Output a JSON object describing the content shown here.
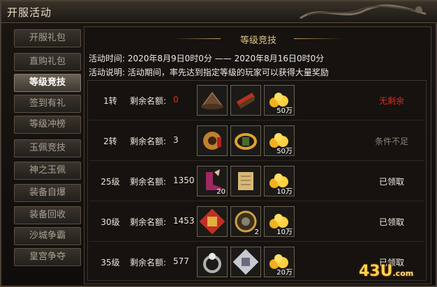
{
  "window": {
    "title": "开服活动"
  },
  "sidebar": {
    "items": [
      {
        "label": "开服礼包"
      },
      {
        "label": "直购礼包"
      },
      {
        "label": "等级竞技"
      },
      {
        "label": "签到有礼"
      },
      {
        "label": "等级冲榜"
      },
      {
        "label": "玉佩竞技"
      },
      {
        "label": "神之玉佩"
      },
      {
        "label": "装备自爆"
      },
      {
        "label": "装备回收"
      },
      {
        "label": "沙城争霸"
      },
      {
        "label": "皇宫争夺"
      }
    ],
    "active_index": 2
  },
  "main": {
    "section_title": "等级竞技",
    "time_line": "活动时间: 2020年8月9日0时0分  ——  2020年8月16日0时0分",
    "desc_line": "活动说明: 活动期间，率先达到指定等级的玩家可以获得大量奖励",
    "remain_label": "剩余名额:",
    "rows": [
      {
        "level": "1转",
        "remain": "0",
        "items": [
          "hat-icon",
          "scroll-bundle-icon",
          "gold-pile-icon"
        ],
        "counts": [
          "",
          "",
          "50万"
        ],
        "status": "无剩余"
      },
      {
        "level": "2转",
        "remain": "3",
        "items": [
          "orb-icon",
          "bracelet-icon",
          "gold-pile-icon"
        ],
        "counts": [
          "",
          "",
          "50万"
        ],
        "status": "条件不足"
      },
      {
        "level": "25级",
        "remain": "1350",
        "items": [
          "boots-icon",
          "scroll-icon",
          "gold-pile-icon"
        ],
        "counts": [
          "20",
          "",
          "10万"
        ],
        "status": "已领取"
      },
      {
        "level": "30级",
        "remain": "1453",
        "items": [
          "seal-icon",
          "medallion-icon",
          "gold-pile-icon"
        ],
        "counts": [
          "",
          "2",
          "10万"
        ],
        "status": "已领取"
      },
      {
        "level": "35级",
        "remain": "577",
        "items": [
          "ring-icon",
          "tile-icon",
          "gold-pile-icon"
        ],
        "counts": [
          "",
          "",
          "20万"
        ],
        "status": "已领取"
      }
    ]
  },
  "logo": {
    "text": "43",
    "text2": "U",
    "suffix": ".com"
  },
  "colors": {
    "accent": "#e0c48a",
    "red": "#e02a20",
    "gold": "#ffd24a"
  }
}
